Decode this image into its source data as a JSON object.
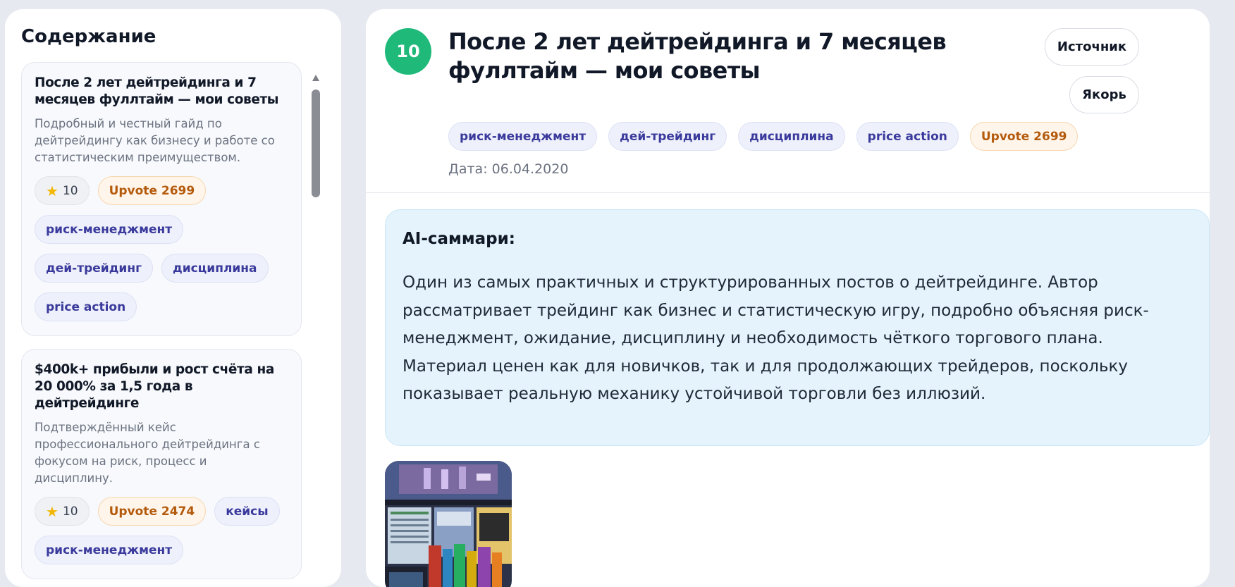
{
  "sidebar": {
    "title": "Содержание",
    "cards": [
      {
        "title": "После 2 лет дейтрейдинга и 7 месяцев фуллтайм — мои советы",
        "description": "Подробный и честный гайд по дейтрейдингу как бизнесу и работе со статистическим преимуществом.",
        "score": "10",
        "upvote": "Upvote 2699",
        "tags": [
          "риск-менеджмент",
          "дей-трейдинг",
          "дисциплина",
          "price action"
        ]
      },
      {
        "title": "$400k+ прибыли и рост счёта на 20 000% за 1,5 года в дейтрейдинге",
        "description": "Подтверждённый кейс профессионального дейтрейдинга с фокусом на риск, процесс и дисциплину.",
        "score": "10",
        "upvote": "Upvote 2474",
        "tags": [
          "кейсы",
          "риск-менеджмент"
        ]
      }
    ]
  },
  "article": {
    "score": "10",
    "title": "После 2 лет дейтрейдинга и 7 месяцев фуллтайм — мои советы",
    "source_label": "Источник",
    "anchor_label": "Якорь",
    "tags": [
      "риск-менеджмент",
      "дей-трейдинг",
      "дисциплина",
      "price action"
    ],
    "upvote": "Upvote 2699",
    "date": "Дата: 06.04.2020",
    "summary_label": "AI-саммари:",
    "summary_text": "Один из самых практичных и структурированных постов о дейтрейдинге. Автор рассматривает трейдинг как бизнес и статистическую игру, подробно объясняя риск-менеджмент, ожидание, дисциплину и необходимость чёткого торгового плана. Материал ценен как для новичков, так и для продолжающих трейдеров, поскольку показывает реальную механику устойчивой торговли без иллюзий."
  },
  "colors": {
    "score_green": "#1fb97a",
    "tag_text": "#3a3a9c",
    "upvote_text": "#b45a0c",
    "summary_bg": "#e5f4fc"
  },
  "icons": {
    "star": "star-icon",
    "scroll_up": "chevron-up-icon"
  }
}
